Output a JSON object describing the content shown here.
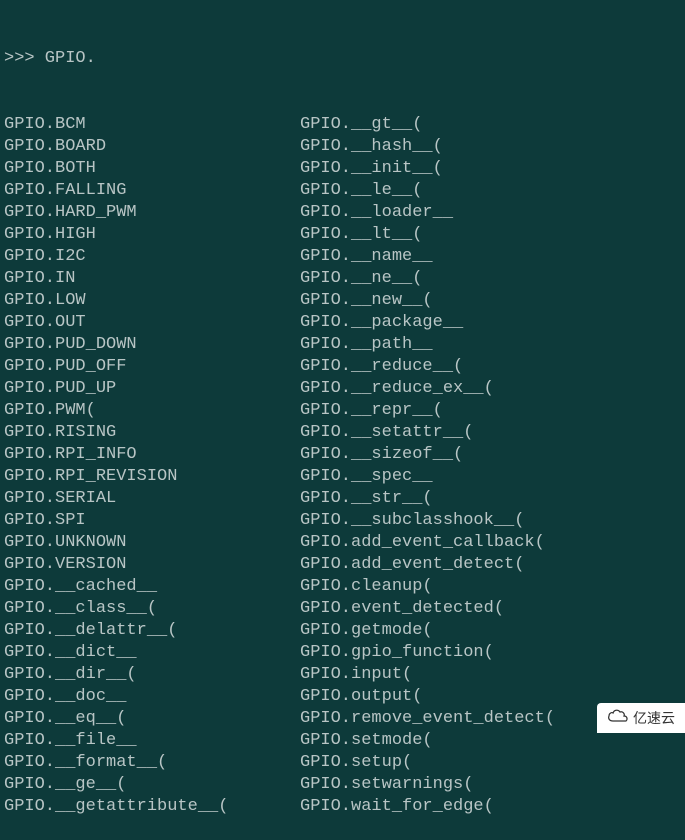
{
  "prompt": ">>> GPIO.",
  "col1": [
    "GPIO.BCM",
    "GPIO.BOARD",
    "GPIO.BOTH",
    "GPIO.FALLING",
    "GPIO.HARD_PWM",
    "GPIO.HIGH",
    "GPIO.I2C",
    "GPIO.IN",
    "GPIO.LOW",
    "GPIO.OUT",
    "GPIO.PUD_DOWN",
    "GPIO.PUD_OFF",
    "GPIO.PUD_UP",
    "GPIO.PWM(",
    "GPIO.RISING",
    "GPIO.RPI_INFO",
    "GPIO.RPI_REVISION",
    "GPIO.SERIAL",
    "GPIO.SPI",
    "GPIO.UNKNOWN",
    "GPIO.VERSION",
    "GPIO.__cached__",
    "GPIO.__class__(",
    "GPIO.__delattr__(",
    "GPIO.__dict__",
    "GPIO.__dir__(",
    "GPIO.__doc__",
    "GPIO.__eq__(",
    "GPIO.__file__",
    "GPIO.__format__(",
    "GPIO.__ge__(",
    "GPIO.__getattribute__("
  ],
  "col2": [
    "GPIO.__gt__(",
    "GPIO.__hash__(",
    "GPIO.__init__(",
    "GPIO.__le__(",
    "GPIO.__loader__",
    "GPIO.__lt__(",
    "GPIO.__name__",
    "GPIO.__ne__(",
    "GPIO.__new__(",
    "GPIO.__package__",
    "GPIO.__path__",
    "GPIO.__reduce__(",
    "GPIO.__reduce_ex__(",
    "GPIO.__repr__(",
    "GPIO.__setattr__(",
    "GPIO.__sizeof__(",
    "GPIO.__spec__",
    "GPIO.__str__(",
    "GPIO.__subclasshook__(",
    "GPIO.add_event_callback(",
    "GPIO.add_event_detect(",
    "GPIO.cleanup(",
    "GPIO.event_detected(",
    "GPIO.getmode(",
    "GPIO.gpio_function(",
    "GPIO.input(",
    "GPIO.output(",
    "GPIO.remove_event_detect(",
    "GPIO.setmode(",
    "GPIO.setup(",
    "GPIO.setwarnings(",
    "GPIO.wait_for_edge("
  ],
  "watermark": {
    "text": "亿速云"
  }
}
